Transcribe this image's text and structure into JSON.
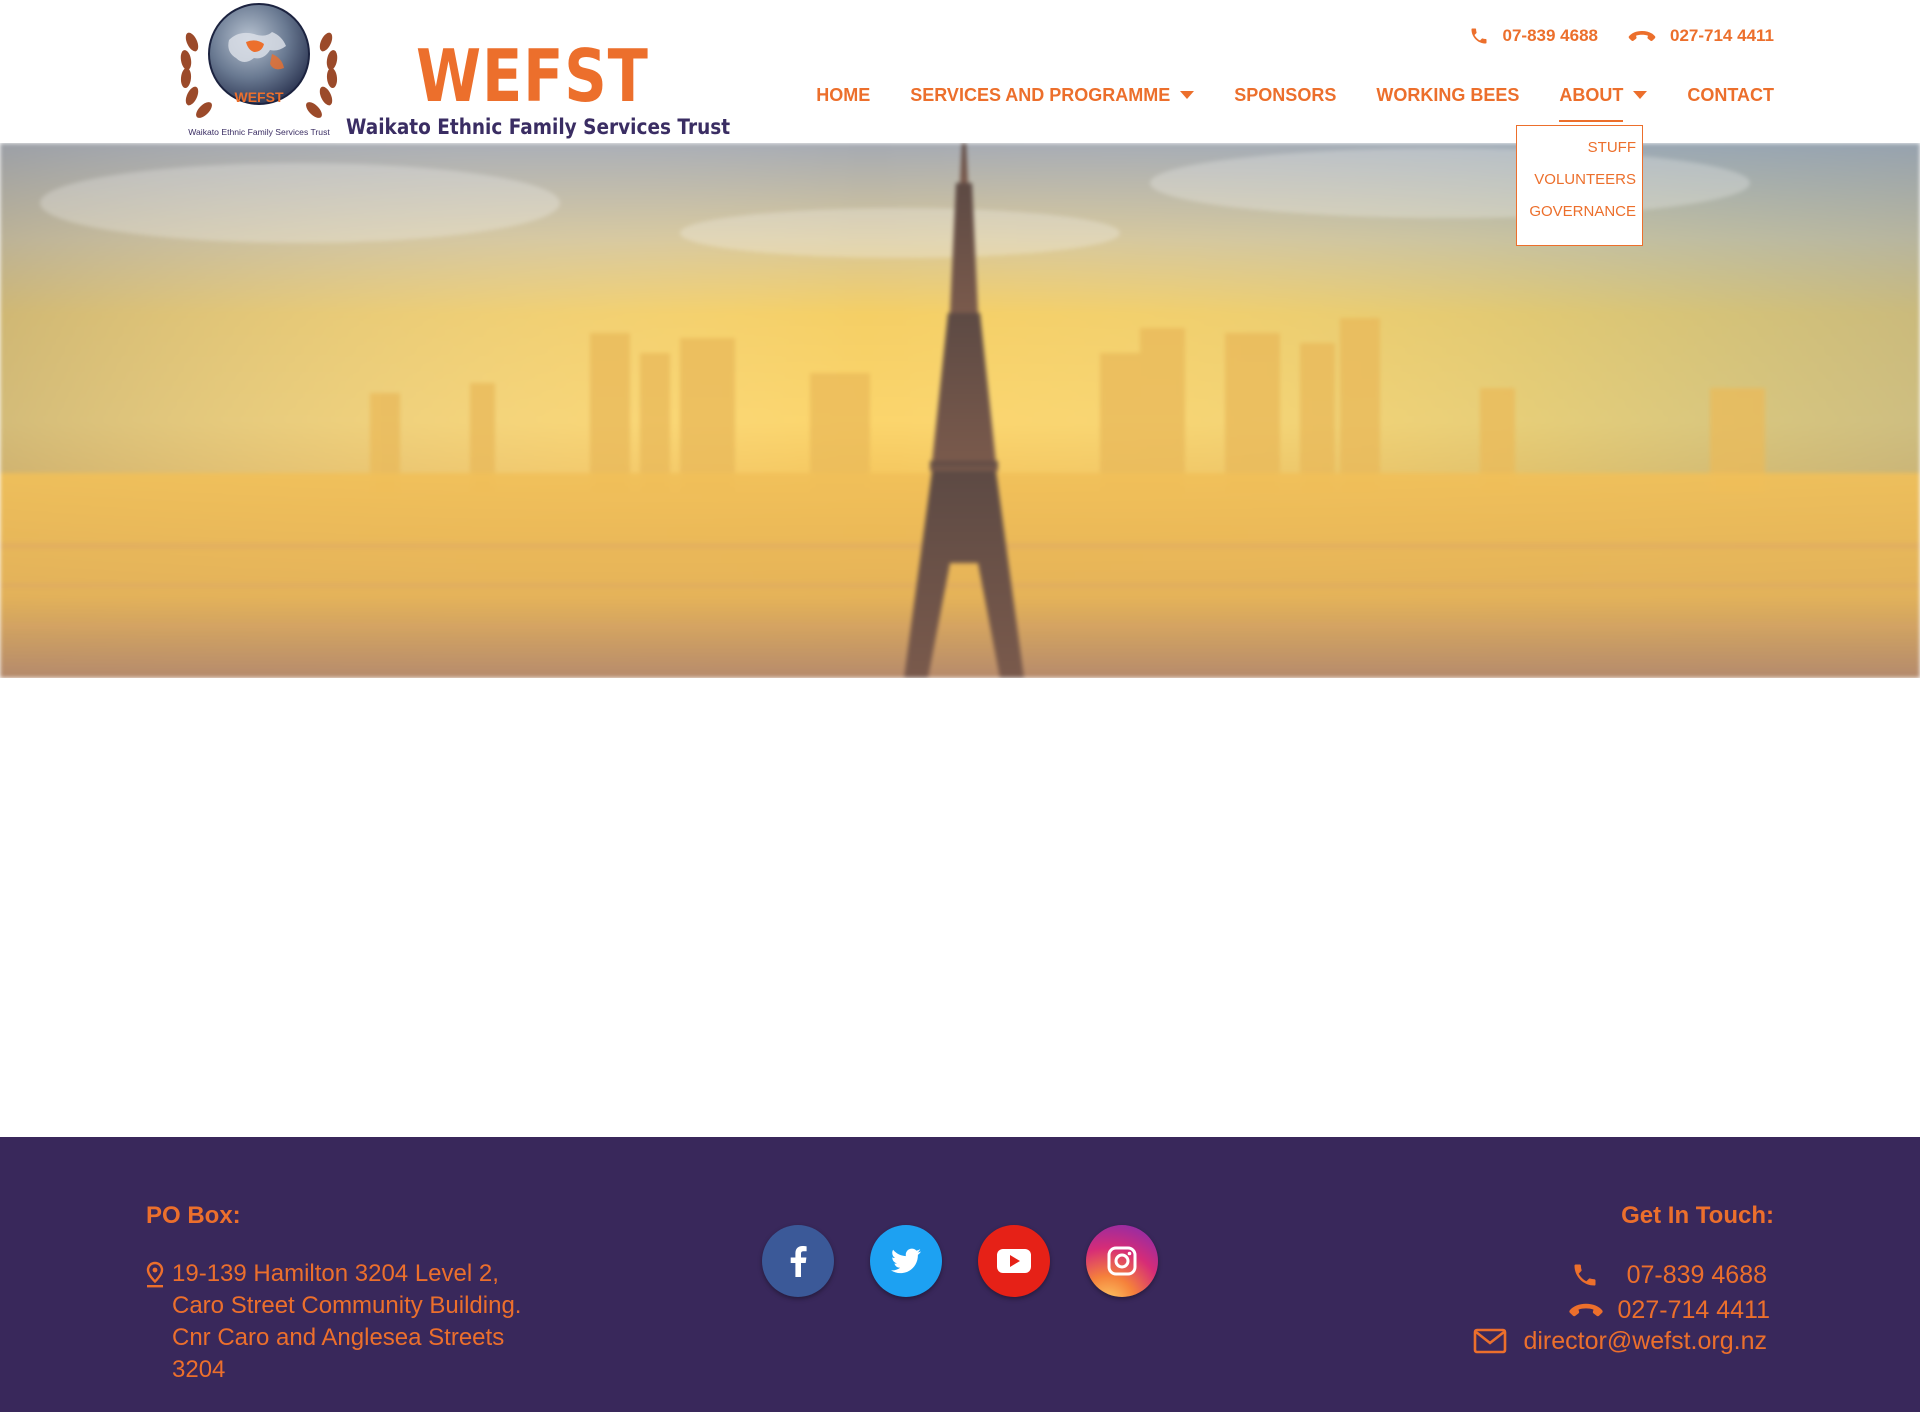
{
  "brand": {
    "emblem_text": "WEFST",
    "emblem_caption": "Waikato Ethnic Family Services Trust",
    "title": "WEFST",
    "subtitle": "Waikato Ethnic Family Services Trust"
  },
  "topbar": {
    "phone": "07-839 4688",
    "mobile": "027-714 4411"
  },
  "nav": {
    "items": [
      {
        "label": "HOME"
      },
      {
        "label": "SERVICES AND PROGRAMME"
      },
      {
        "label": "SPONSORS"
      },
      {
        "label": "WORKING BEES"
      },
      {
        "label": "ABOUT"
      },
      {
        "label": "CONTACT"
      }
    ],
    "about_dropdown": [
      "STUFF",
      "VOLUNTEERS",
      "GOVERNANCE"
    ]
  },
  "footer": {
    "po_heading": "PO Box:",
    "address": "19-139 Hamilton 3204 Level 2, Caro Street Community Building. Cnr Caro and Anglesea Streets 3204",
    "socials": [
      "facebook-icon",
      "twitter-icon",
      "youtube-icon",
      "instagram-icon"
    ],
    "touch_heading": "Get In Touch:",
    "phone": "07-839 4688",
    "mobile": "027-714 4411",
    "email": "director@wefst.org.nz"
  },
  "colors": {
    "accent": "#ec6f2c",
    "footer_bg": "#39285b",
    "subtitle": "#3a2d63"
  }
}
